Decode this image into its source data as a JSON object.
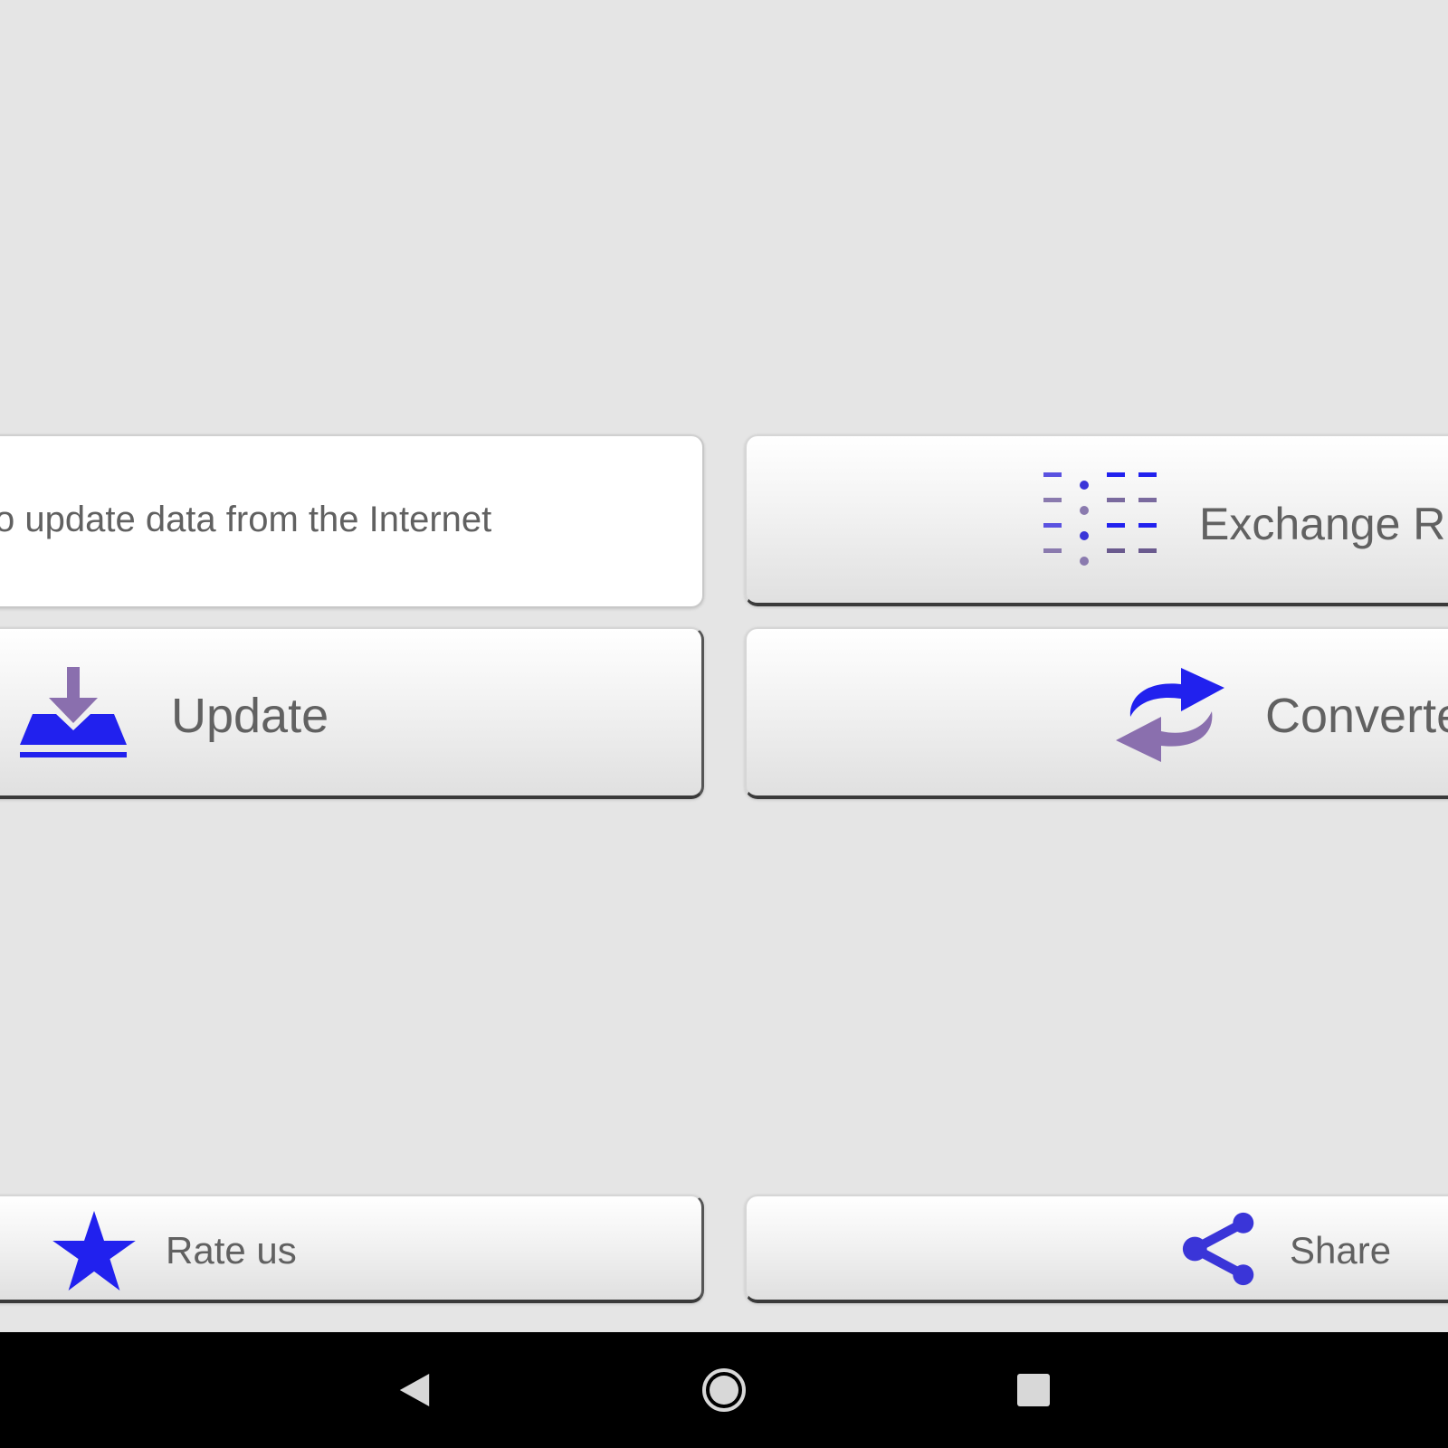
{
  "info_card": {
    "text": "o update data from the Internet"
  },
  "buttons": {
    "exchange_rates": {
      "label": "Exchange R",
      "icon": "list-icon"
    },
    "update": {
      "label": "Update",
      "icon": "download-tray-icon"
    },
    "converter": {
      "label": "Converte",
      "icon": "convert-arrows-icon"
    },
    "rate_us": {
      "label": "Rate us",
      "icon": "star-icon"
    },
    "share": {
      "label": "Share",
      "icon": "share-icon"
    }
  },
  "colors": {
    "accent_blue": "#2121ee",
    "accent_purple": "#8a6fae",
    "background": "#e5e5e5",
    "text": "#616161"
  },
  "navbar": {
    "back": "back-icon",
    "home": "home-icon",
    "recents": "recents-icon"
  }
}
